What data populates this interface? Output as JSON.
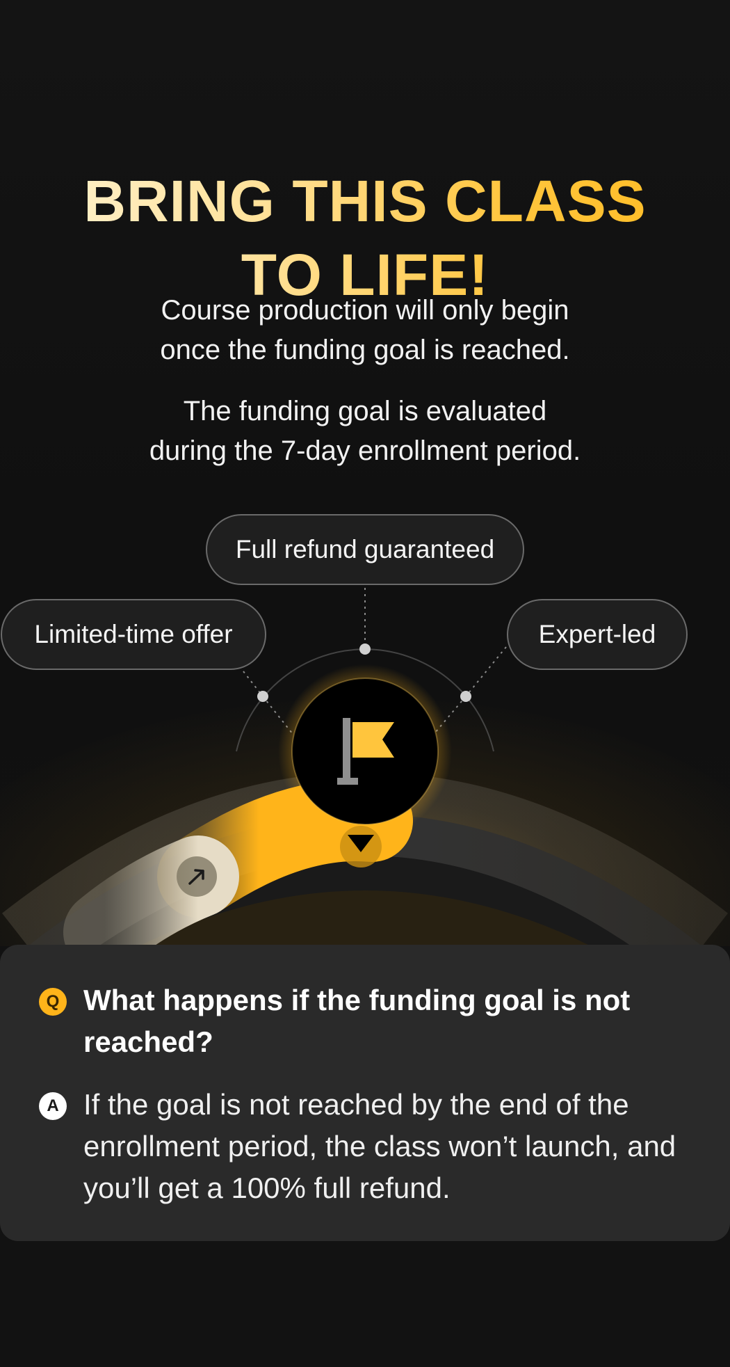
{
  "headline": {
    "line1": "BRING THIS CLASS",
    "line2": "TO LIFE!"
  },
  "description": {
    "paragraph1_line1": "Course production will only begin",
    "paragraph1_line2": "once the funding goal is reached.",
    "paragraph2_line1": "The funding goal is evaluated",
    "paragraph2_line2": "during the 7-day enrollment period."
  },
  "features": {
    "refund": "Full refund guaranteed",
    "limited": "Limited-time offer",
    "expert": "Expert-led"
  },
  "icons": {
    "goal": "flag-icon",
    "progress": "arrow-up-right-icon"
  },
  "colors": {
    "accent": "#ffb41a",
    "accent_light": "#ffe29b",
    "background": "#121212",
    "card": "#2a2a2a"
  },
  "faq": {
    "q_badge": "Q",
    "question": "What happens if the funding goal is not reached?",
    "a_badge": "A",
    "answer": "If the goal is not reached by the end of the enrollment period, the class won’t launch, and you’ll get a 100% full refund."
  }
}
